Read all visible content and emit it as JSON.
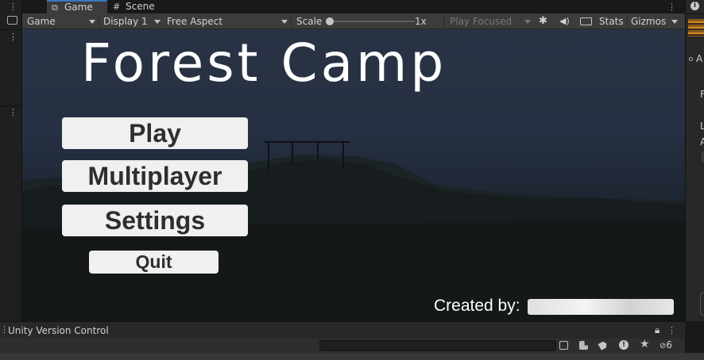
{
  "tabs": [
    {
      "label": "Game",
      "icon": "gamepad-icon"
    },
    {
      "label": "Scene",
      "icon": "grid-icon"
    }
  ],
  "toolbar": {
    "mode": "Game",
    "display": "Display 1",
    "aspect": "Free Aspect",
    "scale_label": "Scale",
    "scale_value": "1x",
    "scale_level": 0.0,
    "play_focused": "Play Focused",
    "stats": "Stats",
    "gizmos": "Gizmos"
  },
  "game": {
    "title": "Forest Camp",
    "buttons": {
      "play": "Play",
      "multiplayer": "Multiplayer",
      "settings": "Settings",
      "quit": "Quit"
    },
    "credit_prefix": "Created by:"
  },
  "bottom": {
    "panel_title": "Unity Version Control",
    "hidden_count": "6"
  },
  "right_strip": {
    "letters": [
      "A",
      "F",
      "L",
      "A"
    ]
  },
  "colors": {
    "accent_tab": "#3a79bb",
    "menu_button_bg": "#f0f0f0",
    "menu_button_text": "#2e2e2e",
    "toolbar_bg": "#3c3c3c",
    "sky_top": "#2a3344"
  }
}
